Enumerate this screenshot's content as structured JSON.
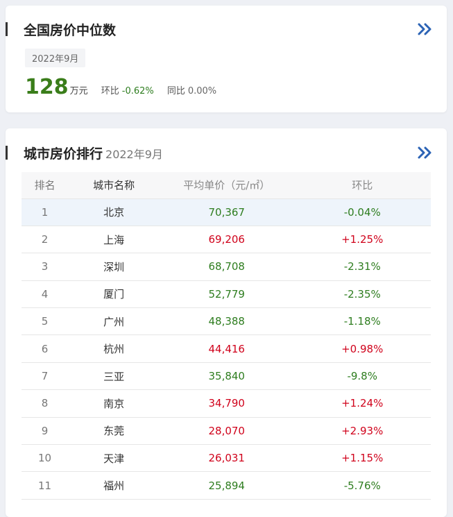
{
  "summary": {
    "title": "全国房价中位数",
    "date": "2022年9月",
    "price": "128",
    "unit": "万元",
    "mom_label": "环比",
    "mom_value": "-0.62%",
    "yoy_label": "同比",
    "yoy_value": "0.00%"
  },
  "ranking": {
    "title": "城市房价排行",
    "date": "2022年9月",
    "headers": [
      "排名",
      "城市名称",
      "平均单价（元/㎡）",
      "环比"
    ],
    "rows": [
      {
        "rank": "1",
        "city": "北京",
        "price": "70,367",
        "change": "-0.04%"
      },
      {
        "rank": "2",
        "city": "上海",
        "price": "69,206",
        "change": "+1.25%"
      },
      {
        "rank": "3",
        "city": "深圳",
        "price": "68,708",
        "change": "-2.31%"
      },
      {
        "rank": "4",
        "city": "厦门",
        "price": "52,779",
        "change": "-2.35%"
      },
      {
        "rank": "5",
        "city": "广州",
        "price": "48,388",
        "change": "-1.18%"
      },
      {
        "rank": "6",
        "city": "杭州",
        "price": "44,416",
        "change": "+0.98%"
      },
      {
        "rank": "7",
        "city": "三亚",
        "price": "35,840",
        "change": "-9.8%"
      },
      {
        "rank": "8",
        "city": "南京",
        "price": "34,790",
        "change": "+1.24%"
      },
      {
        "rank": "9",
        "city": "东莞",
        "price": "28,070",
        "change": "+2.93%"
      },
      {
        "rank": "10",
        "city": "天津",
        "price": "26,031",
        "change": "+1.15%"
      },
      {
        "rank": "11",
        "city": "福州",
        "price": "25,894",
        "change": "-5.76%"
      }
    ]
  },
  "icons": {
    "more": "double-chevron-right-icon"
  },
  "colors": {
    "up": "#d0021b",
    "down": "#2e7d1f",
    "accent": "#2b63b5"
  }
}
